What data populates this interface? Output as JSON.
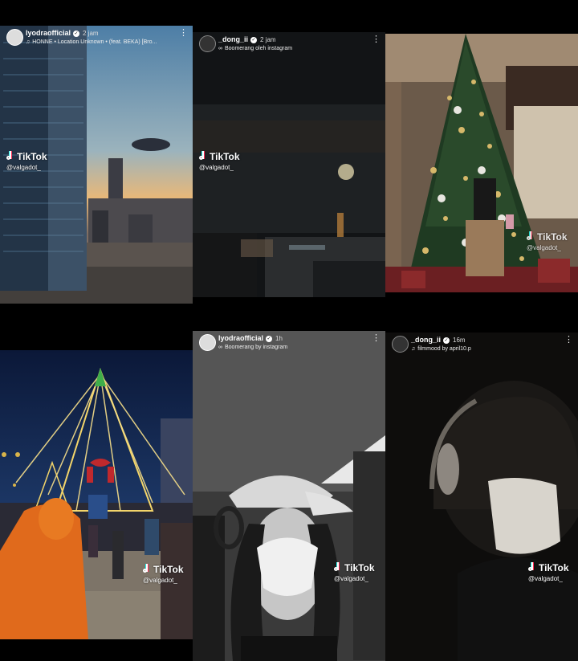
{
  "tiles": {
    "t1": {
      "username": "lyodraofficial",
      "time": "2 jam",
      "subtitle": "HONNE • Location Unknown • (feat. BEKA) [Bro...",
      "tiktok_brand": "TikTok",
      "tiktok_handle": "@valgadot_"
    },
    "t2": {
      "username": "_dong_ii",
      "time": "2 jam",
      "subtitle": "Boomerang oleh instagram",
      "tiktok_brand": "TikTok",
      "tiktok_handle": "@valgadot_"
    },
    "t3": {
      "tiktok_brand": "TikTok",
      "tiktok_handle": "@valgadot_"
    },
    "t4": {
      "tiktok_brand": "TikTok",
      "tiktok_handle": "@valgadot_"
    },
    "t5": {
      "username": "lyodraofficial",
      "time": "1h",
      "subtitle": "Boomerang by instagram",
      "tiktok_brand": "TikTok",
      "tiktok_handle": "@valgadot_"
    },
    "t6": {
      "username": "_dong_ii",
      "time": "16m",
      "subtitle": "filmmood by april10.p",
      "tiktok_brand": "TikTok",
      "tiktok_handle": "@valgadot_"
    }
  },
  "icons": {
    "verified": "verified-badge-icon",
    "more": "more-vertical-icon",
    "music": "music-note-icon",
    "boomerang": "infinity-icon",
    "tiktok": "tiktok-logo-icon"
  }
}
